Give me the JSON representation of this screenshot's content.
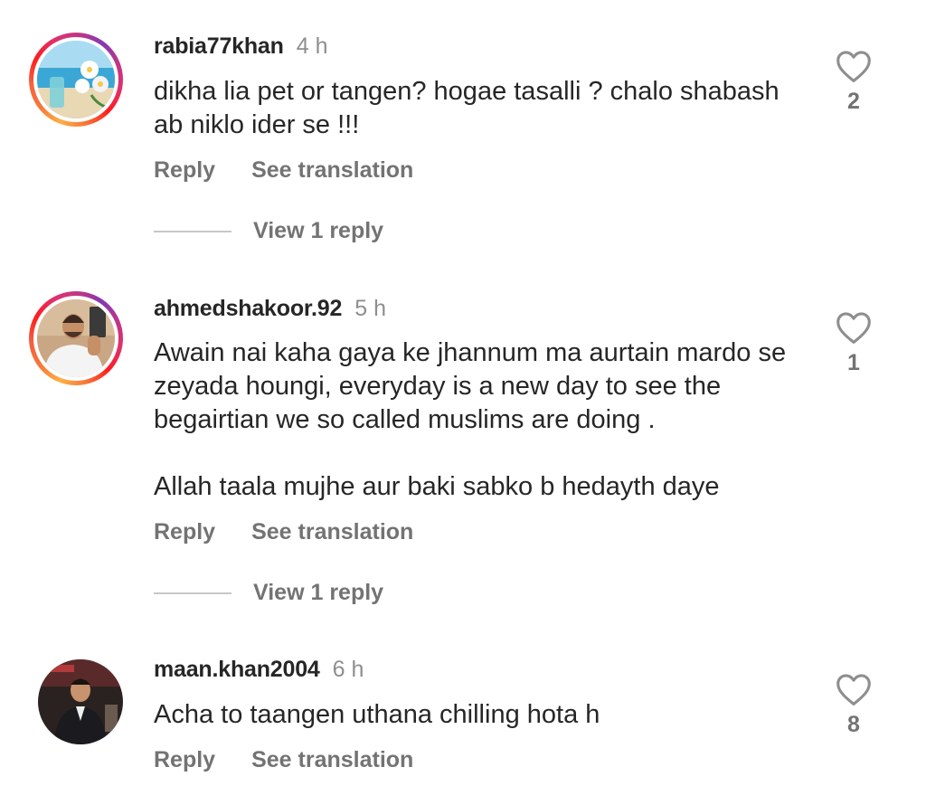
{
  "comments": [
    {
      "username": "rabia77khan",
      "time": "4 h",
      "text": [
        "dikha lia pet or tangen? hogae tasalli ? chalo shabash ab niklo ider se !!!"
      ],
      "reply_label": "Reply",
      "translate_label": "See translation",
      "view_replies_label": "View 1 reply",
      "likes": "2"
    },
    {
      "username": "ahmedshakoor.92",
      "time": "5 h",
      "text": [
        "Awain nai kaha gaya ke jhannum ma aurtain mardo se zeyada houngi, everyday is a new day to see the begairtian we so called muslims are doing .",
        "Allah taala mujhe aur baki sabko b hedayth daye"
      ],
      "reply_label": "Reply",
      "translate_label": "See translation",
      "view_replies_label": "View 1 reply",
      "likes": "1"
    },
    {
      "username": "maan.khan2004",
      "time": "6 h",
      "text": [
        "Acha to taangen uthana chilling hota h"
      ],
      "reply_label": "Reply",
      "translate_label": "See translation",
      "likes": "8"
    }
  ],
  "colors": {
    "text": "#262626",
    "secondary": "#737373",
    "time": "#8e8e8e",
    "divider": "#c7c7c7"
  },
  "icons": {
    "like": "heart-outline-icon"
  }
}
